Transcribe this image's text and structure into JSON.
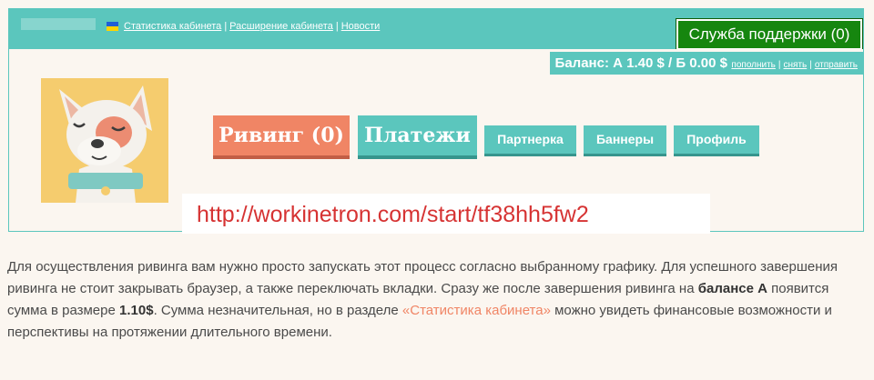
{
  "top_links": {
    "stats": "Статистика кабинета",
    "expand": "Расширение кабинета",
    "news": "Новости",
    "separator": "|"
  },
  "support_button": "Служба поддержки (0)",
  "balance": {
    "text": "Баланс: А 1.40 $ / Б 0.00 $",
    "links": {
      "deposit": "пополнить",
      "withdraw": "снять",
      "send": "отправить"
    },
    "separator": "|"
  },
  "nav": {
    "riving": "Ривинг (0)",
    "payments": "Платежи",
    "partner": "Партнерка",
    "banners": "Баннеры",
    "profile": "Профиль"
  },
  "url_overlay": "http://workinetron.com/start/tf38hh5fw2",
  "description": {
    "part1": "Для осуществления ривинга вам нужно просто запускать этот процесс согласно выбранному графику. Для успешного завершения ривинга не стоит закрывать браузер, а также переключать вкладки. Сразу же после завершения ривинга на ",
    "bold1": "балансе А",
    "part2": " появится сумма в размере ",
    "bold2": "1.10$",
    "part3": ". Сумма незначительная, но в разделе ",
    "link": "«Статистика кабинета»",
    "part4": " можно увидеть финансовые возможности и перспективы на протяжении длительного времени."
  },
  "colors": {
    "teal": "#5bc6bd",
    "green_button": "#16860f",
    "orange_button": "#f08565",
    "url_red": "#d63333"
  },
  "icons": {
    "flag": "ukraine-flag-icon",
    "avatar": "cartoon-dog-avatar"
  }
}
